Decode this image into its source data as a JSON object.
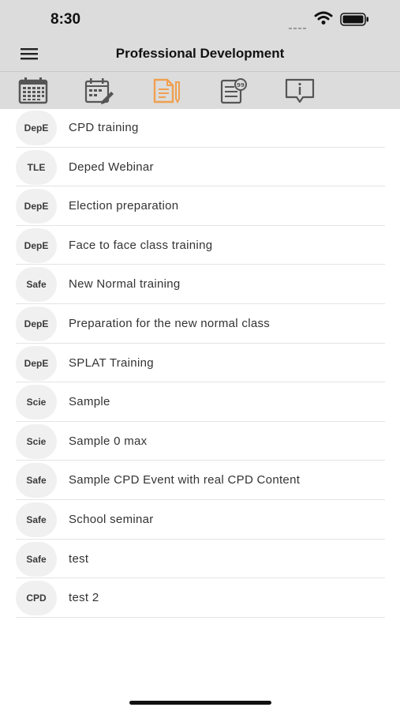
{
  "status_bar": {
    "time": "8:30",
    "icons": [
      "signal-icon",
      "wifi-icon",
      "battery-icon"
    ]
  },
  "header": {
    "title": "Professional Development",
    "menu_icon": "hamburger-menu-icon"
  },
  "toolbar": {
    "tabs": [
      {
        "icon": "calendar-icon",
        "active": false
      },
      {
        "icon": "calendar-edit-icon",
        "active": false
      },
      {
        "icon": "document-edit-icon",
        "active": true
      },
      {
        "icon": "certificate-icon",
        "active": false
      },
      {
        "icon": "info-icon",
        "active": false
      }
    ],
    "active_color": "#f0a050",
    "inactive_color": "#555555"
  },
  "list": {
    "items": [
      {
        "badge": "DepE",
        "label": "CPD training"
      },
      {
        "badge": "TLE",
        "label": "Deped Webinar"
      },
      {
        "badge": "DepE",
        "label": "Election preparation"
      },
      {
        "badge": "DepE",
        "label": "Face to face class training"
      },
      {
        "badge": "Safe",
        "label": "New Normal training"
      },
      {
        "badge": "DepE",
        "label": "Preparation for the new normal class"
      },
      {
        "badge": "DepE",
        "label": "SPLAT Training"
      },
      {
        "badge": "Scie",
        "label": "Sample"
      },
      {
        "badge": "Scie",
        "label": "Sample 0 max"
      },
      {
        "badge": "Safe",
        "label": "Sample CPD Event with real CPD Content"
      },
      {
        "badge": "Safe",
        "label": "School seminar"
      },
      {
        "badge": "Safe",
        "label": "test"
      },
      {
        "badge": "CPD",
        "label": "test 2"
      }
    ]
  }
}
